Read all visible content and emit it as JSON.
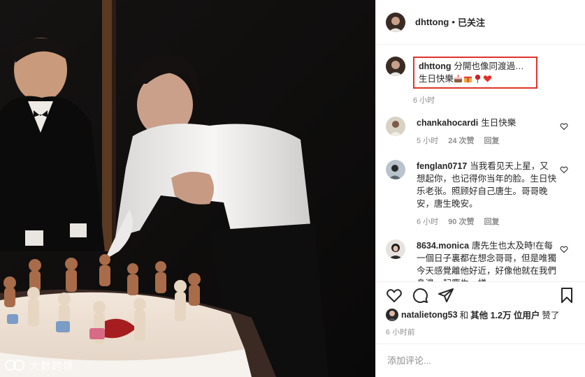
{
  "post": {
    "username": "dhttong",
    "separator": "•",
    "follow_label": "已关注",
    "caption_user": "dhttong",
    "caption_line1": "分開也像同渡過…",
    "caption_line2": "生日快樂",
    "caption_time": "6 小时",
    "emoji_icons": [
      "cake-emoji",
      "gift-emoji",
      "rose-emoji",
      "heart-emoji"
    ]
  },
  "comments": [
    {
      "user": "chankahocardi",
      "text": "生日快樂",
      "time": "5 小时",
      "likes": "24 次赞",
      "reply": "回复"
    },
    {
      "user": "fenglan0717",
      "text": "当我看见天上星，又想起你，也记得你当年的脸。生日快乐老张。照顾好自己唐生。哥哥晚安，唐生晚安。",
      "time": "6 小时",
      "likes": "90 次赞",
      "reply": "回复"
    },
    {
      "user": "8634.monica",
      "text": "唐先生也太及時!在每一個日子裏都在想念哥哥，但是唯獨今天感覺離他好近，好像他就在我們身邊一起慶生一樣。",
      "time": "",
      "likes": "",
      "reply": ""
    }
  ],
  "likes": {
    "user": "natalietong53",
    "and_label": "和",
    "others_label": "其他 1.2万 位用户",
    "liked_label": "赞了"
  },
  "post_time": "6 小时前",
  "add_comment": {
    "placeholder": "添加评论..."
  },
  "watermark": {
    "text": "大數跨境"
  },
  "colors": {
    "highlight_border": "#e0322a",
    "muted_text": "#8e8e8e"
  }
}
